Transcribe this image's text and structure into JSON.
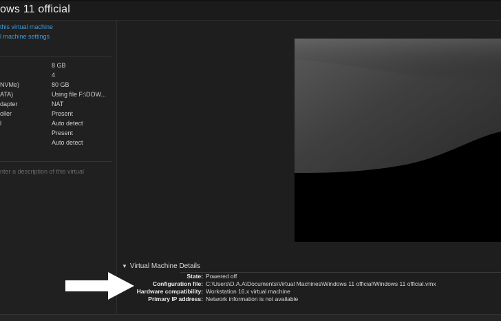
{
  "window": {
    "title": "ows 11 official"
  },
  "actions": [
    "this virtual machine",
    "l machine settings"
  ],
  "hardware": [
    {
      "label": "",
      "value": "8 GB"
    },
    {
      "label": "",
      "value": "4"
    },
    {
      "label": "NVMe)",
      "value": "80 GB"
    },
    {
      "label": "ATA)",
      "value": "Using file F:\\DOW..."
    },
    {
      "label": "dapter",
      "value": "NAT"
    },
    {
      "label": "oller",
      "value": "Present"
    },
    {
      "label": "l",
      "value": "Auto detect"
    },
    {
      "label": "",
      "value": "Present"
    },
    {
      "label": "",
      "value": "Auto detect"
    }
  ],
  "description_placeholder": "nter a description of this virtual",
  "details": {
    "header": "Virtual Machine Details",
    "rows": [
      {
        "label": "State:",
        "value": "Powered off"
      },
      {
        "label": "Configuration file:",
        "value": "C:\\Users\\D.A.A\\Documents\\Virtual Machines\\Windows 11 official\\Windows 11 official.vmx"
      },
      {
        "label": "Hardware compatibility:",
        "value": "Workstation 16.x virtual machine"
      },
      {
        "label": "Primary IP address:",
        "value": "Network information is not available"
      }
    ]
  },
  "colors": {
    "link": "#3d9ad8",
    "background": "#1e1e1e",
    "arrow": "#ffffff"
  }
}
